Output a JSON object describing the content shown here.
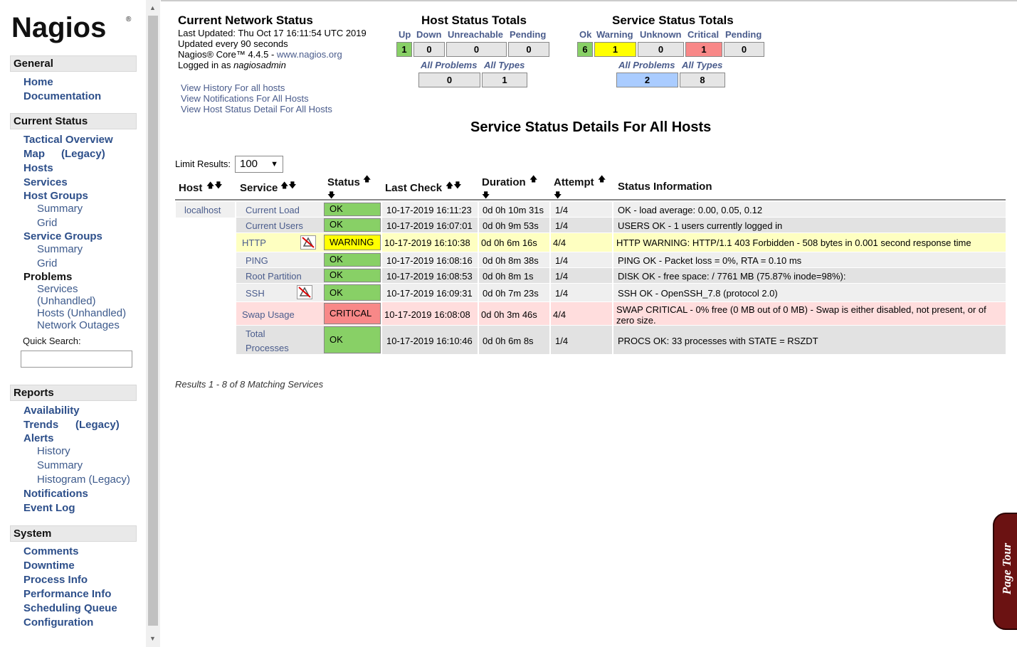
{
  "logo": {
    "text": "Nagios",
    "mark": "®"
  },
  "sidebar": {
    "general": {
      "title": "General",
      "home": "Home",
      "documentation": "Documentation"
    },
    "current_status": {
      "title": "Current Status",
      "tactical": "Tactical Overview",
      "map": "Map",
      "map_legacy": "(Legacy)",
      "hosts": "Hosts",
      "services": "Services",
      "host_groups": "Host Groups",
      "hg_summary": "Summary",
      "hg_grid": "Grid",
      "service_groups": "Service Groups",
      "sg_summary": "Summary",
      "sg_grid": "Grid",
      "problems": "Problems",
      "p_services": "Services",
      "p_unhandled": "(Unhandled)",
      "p_hosts_unhandled": "Hosts (Unhandled)",
      "p_network_outages": "Network Outages",
      "quick_search": "Quick Search:"
    },
    "reports": {
      "title": "Reports",
      "availability": "Availability",
      "trends": "Trends",
      "trends_legacy": "(Legacy)",
      "alerts": "Alerts",
      "a_history": "History",
      "a_summary": "Summary",
      "a_histogram": "Histogram (Legacy)",
      "notifications": "Notifications",
      "event_log": "Event Log"
    },
    "system": {
      "title": "System",
      "comments": "Comments",
      "downtime": "Downtime",
      "process_info": "Process Info",
      "performance_info": "Performance Info",
      "scheduling_queue": "Scheduling Queue",
      "configuration": "Configuration"
    }
  },
  "network_status": {
    "title": "Current Network Status",
    "last_updated": "Last Updated: Thu Oct 17 16:11:54 UTC 2019",
    "update_interval": "Updated every 90 seconds",
    "core_prefix": "Nagios® Core™ 4.4.5 - ",
    "core_link": "www.nagios.org",
    "logged_prefix": "Logged in as ",
    "user": "nagiosadmin",
    "link_history": "View History For all hosts",
    "link_notifications": "View Notifications For All Hosts",
    "link_host_detail": "View Host Status Detail For All Hosts"
  },
  "host_totals": {
    "title": "Host Status Totals",
    "headers": [
      "Up",
      "Down",
      "Unreachable",
      "Pending"
    ],
    "values": [
      "1",
      "0",
      "0",
      "0"
    ],
    "all_problems_label": "All Problems",
    "all_types_label": "All Types",
    "all_problems": "0",
    "all_types": "1"
  },
  "service_totals": {
    "title": "Service Status Totals",
    "headers": [
      "Ok",
      "Warning",
      "Unknown",
      "Critical",
      "Pending"
    ],
    "values": [
      "6",
      "1",
      "0",
      "1",
      "0"
    ],
    "all_problems_label": "All Problems",
    "all_types_label": "All Types",
    "all_problems": "2",
    "all_types": "8"
  },
  "page_heading": "Service Status Details For All Hosts",
  "limit": {
    "label": "Limit Results:",
    "value": "100"
  },
  "table": {
    "headers": {
      "host": "Host",
      "service": "Service",
      "status": "Status",
      "last_check": "Last Check",
      "duration": "Duration",
      "attempt": "Attempt",
      "info": "Status Information"
    },
    "host": "localhost",
    "rows": [
      {
        "service": "Current Load",
        "status": "OK",
        "last_check": "10-17-2019 16:11:23",
        "duration": "0d 0h 10m 31s",
        "attempt": "1/4",
        "info": "OK - load average: 0.00, 0.05, 0.12"
      },
      {
        "service": "Current Users",
        "status": "OK",
        "last_check": "10-17-2019 16:07:01",
        "duration": "0d 0h 9m 53s",
        "attempt": "1/4",
        "info": "USERS OK - 1 users currently logged in"
      },
      {
        "service": "HTTP",
        "status": "WARNING",
        "last_check": "10-17-2019 16:10:38",
        "duration": "0d 0h 6m 16s",
        "attempt": "4/4",
        "info": "HTTP WARNING: HTTP/1.1 403 Forbidden - 508 bytes in 0.001 second response time"
      },
      {
        "service": "PING",
        "status": "OK",
        "last_check": "10-17-2019 16:08:16",
        "duration": "0d 0h 8m 38s",
        "attempt": "1/4",
        "info": "PING OK - Packet loss = 0%, RTA = 0.10 ms"
      },
      {
        "service": "Root Partition",
        "status": "OK",
        "last_check": "10-17-2019 16:08:53",
        "duration": "0d 0h 8m 1s",
        "attempt": "1/4",
        "info": "DISK OK - free space: / 7761 MB (75.87% inode=98%):"
      },
      {
        "service": "SSH",
        "status": "OK",
        "last_check": "10-17-2019 16:09:31",
        "duration": "0d 0h 7m 23s",
        "attempt": "1/4",
        "info": "SSH OK - OpenSSH_7.8 (protocol 2.0)"
      },
      {
        "service": "Swap Usage",
        "status": "CRITICAL",
        "last_check": "10-17-2019 16:08:08",
        "duration": "0d 0h 3m 46s",
        "attempt": "4/4",
        "info": "SWAP CRITICAL - 0% free (0 MB out of 0 MB) - Swap is either disabled, not present, or of",
        "info_line2": "zero size."
      },
      {
        "service": "Total",
        "service_line2": "Processes",
        "status": "OK",
        "last_check": "10-17-2019 16:10:46",
        "duration": "0d 0h 6m 8s",
        "attempt": "1/4",
        "info": "PROCS OK: 33 processes with STATE = RSZDT"
      }
    ]
  },
  "results_text": "Results 1 - 8 of 8 Matching Services",
  "page_tour": "Page Tour",
  "colors": {
    "ok": "#88d066",
    "warning": "#ffff00",
    "critical": "#f88888",
    "link": "#4a5c8c"
  }
}
